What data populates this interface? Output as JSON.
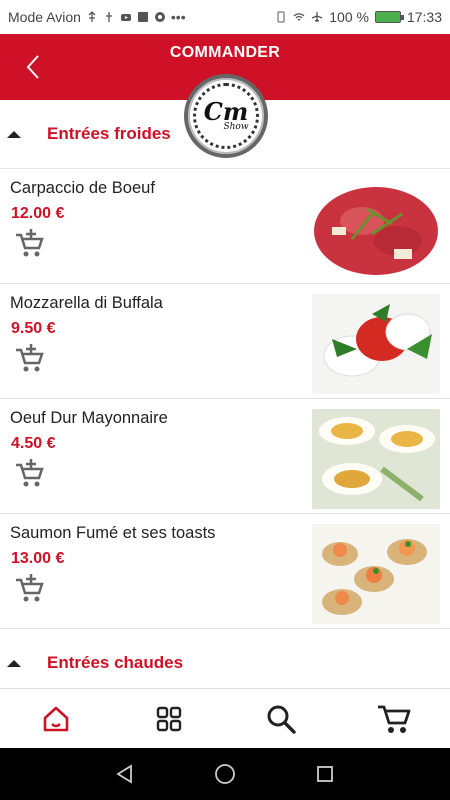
{
  "status_bar": {
    "carrier": "Mode Avion",
    "battery": "100 %",
    "time": "17:33"
  },
  "header": {
    "title": "COMMANDER"
  },
  "logo": {
    "main": "Cm",
    "sub": "Show"
  },
  "sections": [
    {
      "title": "Entrées froides",
      "items": [
        {
          "name": "Carpaccio de Boeuf",
          "price": "12.00 €"
        },
        {
          "name": "Mozzarella di Buffala",
          "price": "9.50 €"
        },
        {
          "name": "Oeuf Dur Mayonnaire",
          "price": "4.50 €"
        },
        {
          "name": "Saumon Fumé et ses toasts",
          "price": "13.00 €"
        }
      ]
    },
    {
      "title": "Entrées chaudes",
      "items": []
    }
  ],
  "bottom_nav": [
    "home-icon",
    "grid-icon",
    "search-icon",
    "cart-icon"
  ],
  "colors": {
    "accent": "#cf1127",
    "text": "#222222"
  }
}
